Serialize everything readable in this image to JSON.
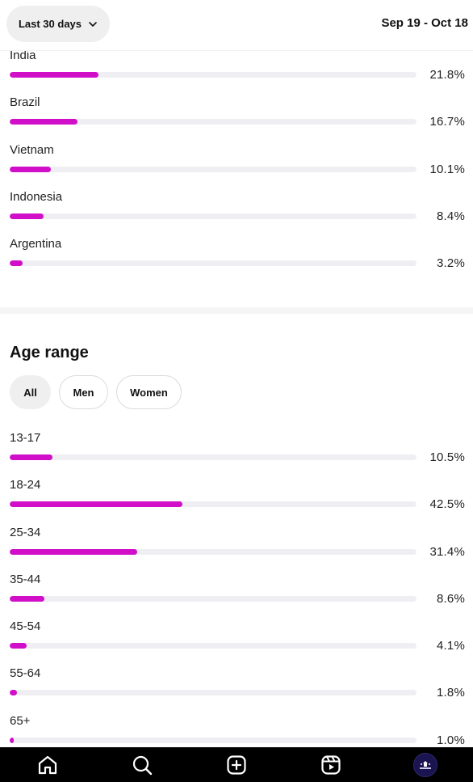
{
  "header": {
    "range_label": "Last 30 days",
    "date_range": "Sep 19 - Oct 18"
  },
  "colors": {
    "bar": "#d10fc9",
    "track": "#efeff3"
  },
  "countries": [
    {
      "label": "India",
      "pct": "21.8%",
      "value": 21.8
    },
    {
      "label": "Brazil",
      "pct": "16.7%",
      "value": 16.7
    },
    {
      "label": "Vietnam",
      "pct": "10.1%",
      "value": 10.1
    },
    {
      "label": "Indonesia",
      "pct": "8.4%",
      "value": 8.4
    },
    {
      "label": "Argentina",
      "pct": "3.2%",
      "value": 3.2
    }
  ],
  "age": {
    "title": "Age range",
    "filters": [
      "All",
      "Men",
      "Women"
    ],
    "active_filter": "All",
    "rows": [
      {
        "label": "13-17",
        "pct": "10.5%",
        "value": 10.5
      },
      {
        "label": "18-24",
        "pct": "42.5%",
        "value": 42.5
      },
      {
        "label": "25-34",
        "pct": "31.4%",
        "value": 31.4
      },
      {
        "label": "35-44",
        "pct": "8.6%",
        "value": 8.6
      },
      {
        "label": "45-54",
        "pct": "4.1%",
        "value": 4.1
      },
      {
        "label": "55-64",
        "pct": "1.8%",
        "value": 1.8
      },
      {
        "label": "65+",
        "pct": "1.0%",
        "value": 1.0
      }
    ]
  },
  "nav": {
    "items": [
      "home-icon",
      "search-icon",
      "create-icon",
      "reels-icon",
      "profile-avatar"
    ]
  }
}
